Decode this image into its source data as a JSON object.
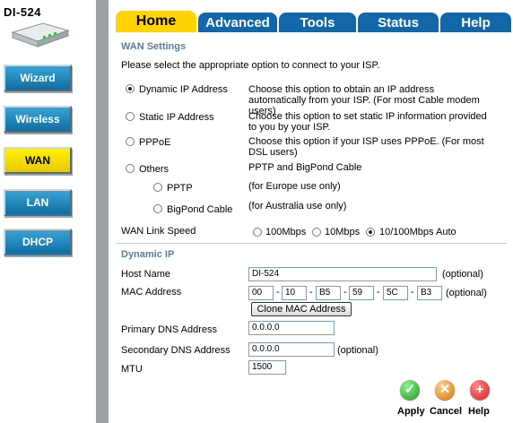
{
  "sidebar": {
    "model": "DI-524",
    "nav": [
      {
        "label": "Wizard",
        "active": false
      },
      {
        "label": "Wireless",
        "active": false
      },
      {
        "label": "WAN",
        "active": true
      },
      {
        "label": "LAN",
        "active": false
      },
      {
        "label": "DHCP",
        "active": false
      }
    ]
  },
  "tabs": [
    {
      "label": "Home",
      "active": true
    },
    {
      "label": "Advanced",
      "active": false
    },
    {
      "label": "Tools",
      "active": false
    },
    {
      "label": "Status",
      "active": false
    },
    {
      "label": "Help",
      "active": false
    }
  ],
  "wan": {
    "section_title": "WAN Settings",
    "intro": "Please select the appropriate option to connect to your ISP.",
    "options": {
      "dynamic": {
        "label": "Dynamic IP Address",
        "desc": "Choose this option to obtain an IP address automatically from your ISP. (For most Cable modem users)",
        "selected": true
      },
      "static": {
        "label": "Static IP Address",
        "desc": "Choose this option to set static IP information provided to you by your ISP.",
        "selected": false
      },
      "pppoe": {
        "label": "PPPoE",
        "desc": "Choose this option if your ISP uses PPPoE. (For most DSL users)",
        "selected": false
      },
      "others": {
        "label": "Others",
        "desc": "PPTP and BigPond Cable",
        "selected": false
      },
      "pptp": {
        "label": "PPTP",
        "desc": "(for Europe use only)",
        "selected": false
      },
      "bigpond": {
        "label": "BigPond Cable",
        "desc": "(for Australia use only)",
        "selected": false
      }
    },
    "link_speed": {
      "label": "WAN Link Speed",
      "options": [
        "100Mbps",
        "10Mbps",
        "10/100Mbps Auto"
      ],
      "selected": "10/100Mbps Auto"
    }
  },
  "dynamic_ip": {
    "section_title": "Dynamic IP",
    "host_name_label": "Host Name",
    "host_name": "DI-524",
    "host_optional": "(optional)",
    "mac_label": "MAC Address",
    "mac": [
      "00",
      "10",
      "B5",
      "59",
      "5C",
      "B3"
    ],
    "mac_optional": "(optional)",
    "clone_button": "Clone MAC Address",
    "primary_dns_label": "Primary DNS Address",
    "primary_dns": "0.0.0.0",
    "secondary_dns_label": "Secondary DNS Address",
    "secondary_dns": "0.0.0.0",
    "secondary_optional": "(optional)",
    "mtu_label": "MTU",
    "mtu": "1500"
  },
  "footer": {
    "apply": "Apply",
    "cancel": "Cancel",
    "help": "Help"
  },
  "colors": {
    "tab_blue": "#1167a7",
    "tab_active": "#ffd400",
    "nav_blue": "#1a86be",
    "nav_active": "#fff200",
    "section_title": "#5a7d9a"
  }
}
